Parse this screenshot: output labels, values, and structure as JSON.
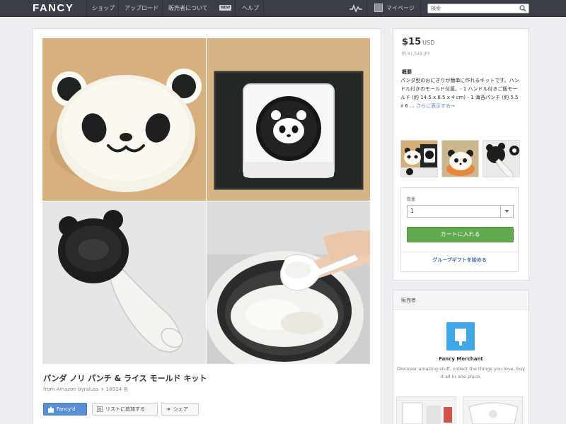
{
  "topbar": {
    "logo": "FANCY",
    "nav": [
      "ショップ",
      "アップロード",
      "販売者について",
      "ヘルプ"
    ],
    "new_badge": "NEW",
    "account_label": "マイページ",
    "search_placeholder": "検索"
  },
  "product": {
    "title": "パンダ ノリ パンチ & ライス モールド キット",
    "meta": "from Amazon byraluss + 16914 名",
    "actions": {
      "fancy": "Fancy'd",
      "add_list": "リストに追加する",
      "share": "シェア"
    }
  },
  "purchase": {
    "price": "$15",
    "currency": "USD",
    "price_jpy": "約 ¥1,549 JPY",
    "desc_label": "概要",
    "description": "パンダ型のおにぎりが簡単に作れるキットです。ハンドル付きのモールド付属。- 1 ハンドル付きご飯モールド (約 14.5 x 8.5 x 4 cm) - 1 海苔パンチ (約 5.5 x 6 ...",
    "more_link": "さらに表示する→",
    "qty_label": "数量",
    "qty_value": "1",
    "cart_button": "カートに入れる",
    "gift_link": "グループギフトを始める"
  },
  "seller": {
    "heading": "販売者",
    "name": "Fancy Merchant",
    "tagline": "Discover amazing stuff, collect the things you love, buy it all in one place."
  },
  "colors": {
    "topbar": "#3a3f47",
    "cart_green": "#61a94d",
    "fancy_blue": "#5b8fd3",
    "merchant_blue": "#41a6e6",
    "link": "#4a6fb3"
  }
}
